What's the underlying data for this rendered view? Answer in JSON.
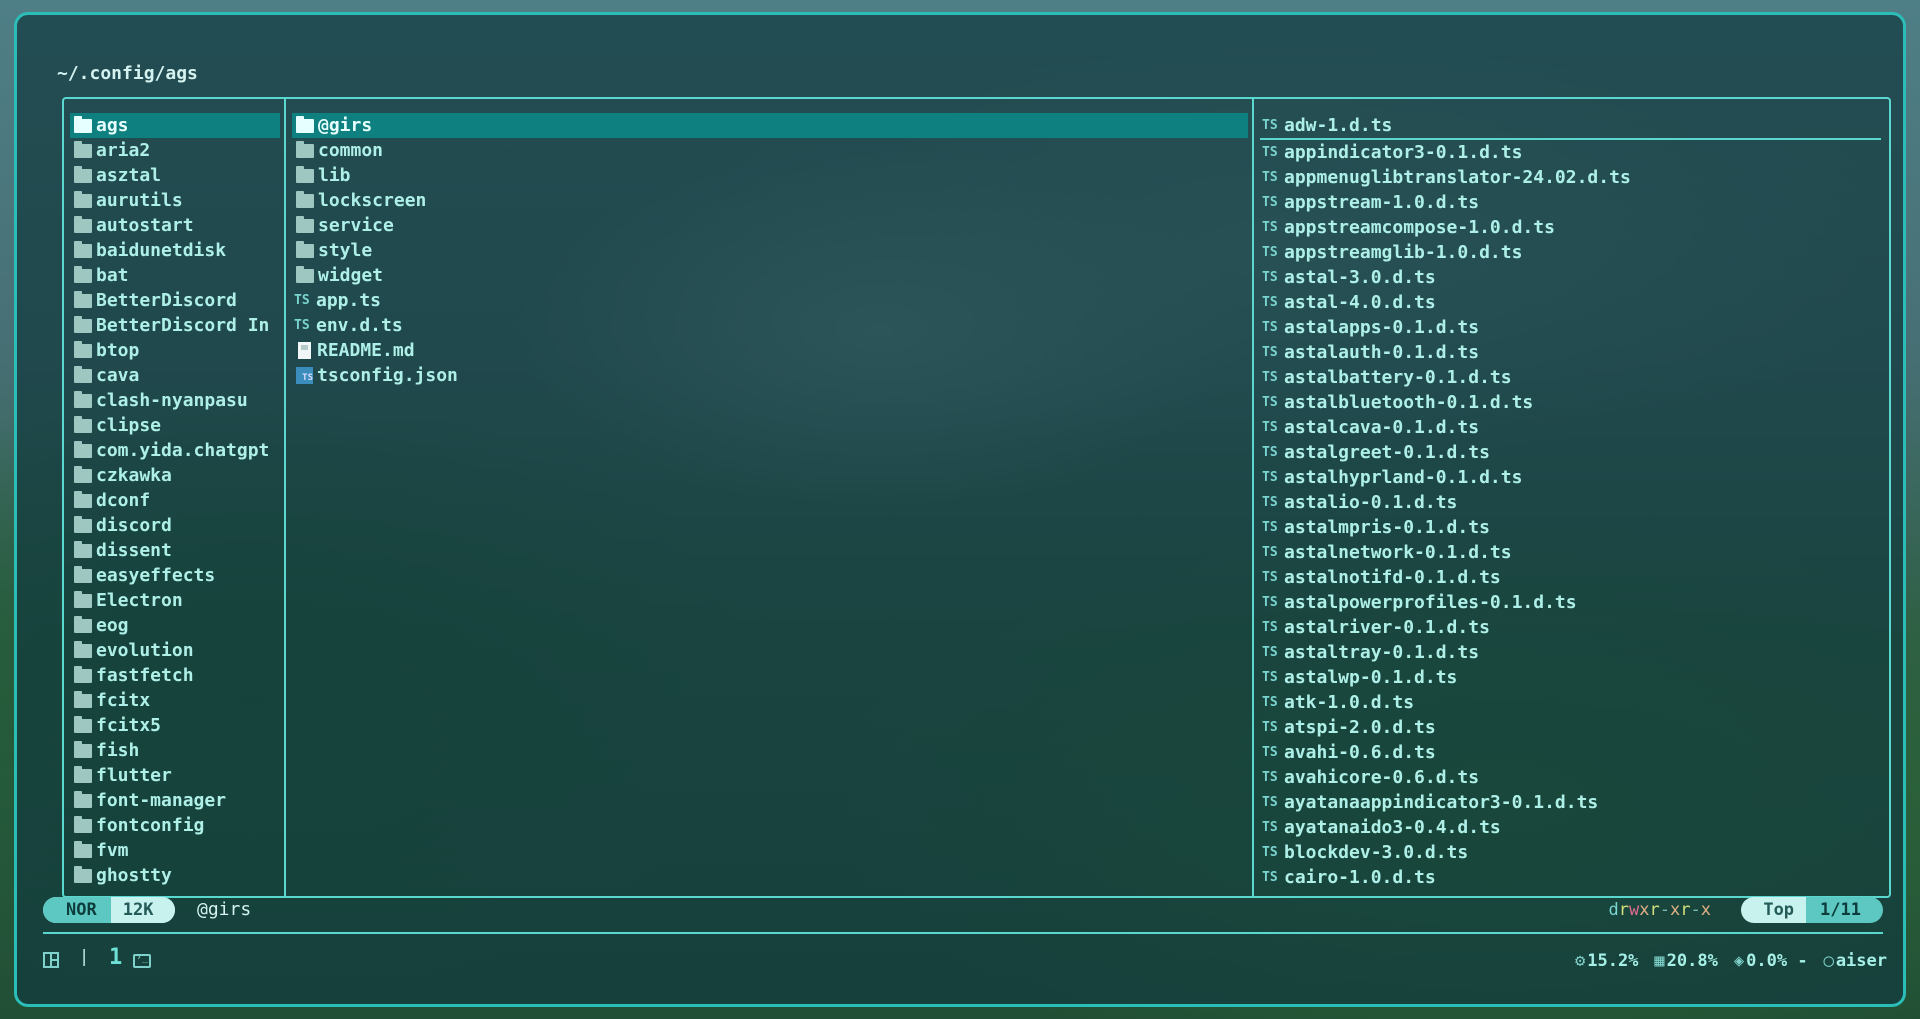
{
  "path": "~/.config/ags",
  "left_pane": [
    {
      "name": "ags",
      "selected": true
    },
    {
      "name": "aria2"
    },
    {
      "name": "asztal"
    },
    {
      "name": "aurutils"
    },
    {
      "name": "autostart"
    },
    {
      "name": "baidunetdisk"
    },
    {
      "name": "bat"
    },
    {
      "name": "BetterDiscord"
    },
    {
      "name": "BetterDiscord In"
    },
    {
      "name": "btop"
    },
    {
      "name": "cava"
    },
    {
      "name": "clash-nyanpasu"
    },
    {
      "name": "clipse"
    },
    {
      "name": "com.yida.chatgpt"
    },
    {
      "name": "czkawka"
    },
    {
      "name": "dconf"
    },
    {
      "name": "discord"
    },
    {
      "name": "dissent"
    },
    {
      "name": "easyeffects"
    },
    {
      "name": "Electron"
    },
    {
      "name": "eog"
    },
    {
      "name": "evolution"
    },
    {
      "name": "fastfetch"
    },
    {
      "name": "fcitx"
    },
    {
      "name": "fcitx5"
    },
    {
      "name": "fish"
    },
    {
      "name": "flutter"
    },
    {
      "name": "font-manager"
    },
    {
      "name": "fontconfig"
    },
    {
      "name": "fvm"
    },
    {
      "name": "ghostty"
    }
  ],
  "middle_pane": [
    {
      "name": "@girs",
      "type": "folder",
      "selected": true
    },
    {
      "name": "common",
      "type": "folder"
    },
    {
      "name": "lib",
      "type": "folder"
    },
    {
      "name": "lockscreen",
      "type": "folder"
    },
    {
      "name": "service",
      "type": "folder"
    },
    {
      "name": "style",
      "type": "folder"
    },
    {
      "name": "widget",
      "type": "folder"
    },
    {
      "name": "app.ts",
      "type": "ts"
    },
    {
      "name": "env.d.ts",
      "type": "ts"
    },
    {
      "name": "README.md",
      "type": "md"
    },
    {
      "name": "tsconfig.json",
      "type": "tsconfig"
    }
  ],
  "ts_badge": "TS",
  "right_pane": [
    "adw-1.d.ts",
    "appindicator3-0.1.d.ts",
    "appmenuglibtranslator-24.02.d.ts",
    "appstream-1.0.d.ts",
    "appstreamcompose-1.0.d.ts",
    "appstreamglib-1.0.d.ts",
    "astal-3.0.d.ts",
    "astal-4.0.d.ts",
    "astalapps-0.1.d.ts",
    "astalauth-0.1.d.ts",
    "astalbattery-0.1.d.ts",
    "astalbluetooth-0.1.d.ts",
    "astalcava-0.1.d.ts",
    "astalgreet-0.1.d.ts",
    "astalhyprland-0.1.d.ts",
    "astalio-0.1.d.ts",
    "astalmpris-0.1.d.ts",
    "astalnetwork-0.1.d.ts",
    "astalnotifd-0.1.d.ts",
    "astalpowerprofiles-0.1.d.ts",
    "astalriver-0.1.d.ts",
    "astaltray-0.1.d.ts",
    "astalwp-0.1.d.ts",
    "atk-1.0.d.ts",
    "atspi-2.0.d.ts",
    "avahi-0.6.d.ts",
    "avahicore-0.6.d.ts",
    "ayatanaappindicator3-0.1.d.ts",
    "ayatanaido3-0.4.d.ts",
    "blockdev-3.0.d.ts",
    "cairo-1.0.d.ts"
  ],
  "status": {
    "mode": "NOR",
    "size": "12K",
    "hovered": "@girs",
    "permissions": {
      "d": "d",
      "r1": "r",
      "w1": "w",
      "x1": "x",
      "n1": "r",
      "n2": "-",
      "x2": "x",
      "n3": "r",
      "n4": "-",
      "x3": "x"
    },
    "scroll": "Top",
    "position": "1/11"
  },
  "bottom_bar": {
    "pipe": "|",
    "workspace": "1",
    "cpu": "15.2%",
    "mem": "20.8%",
    "disk": "0.0%",
    "dash": "-",
    "user": "aiser",
    "icons": [
      "layout-icon",
      "terminal-icon",
      "cpu-icon",
      "memory-icon",
      "layers-icon",
      "user-icon"
    ]
  },
  "colors": {
    "accent": "#5ad7cf",
    "selection": "#0e8080"
  }
}
